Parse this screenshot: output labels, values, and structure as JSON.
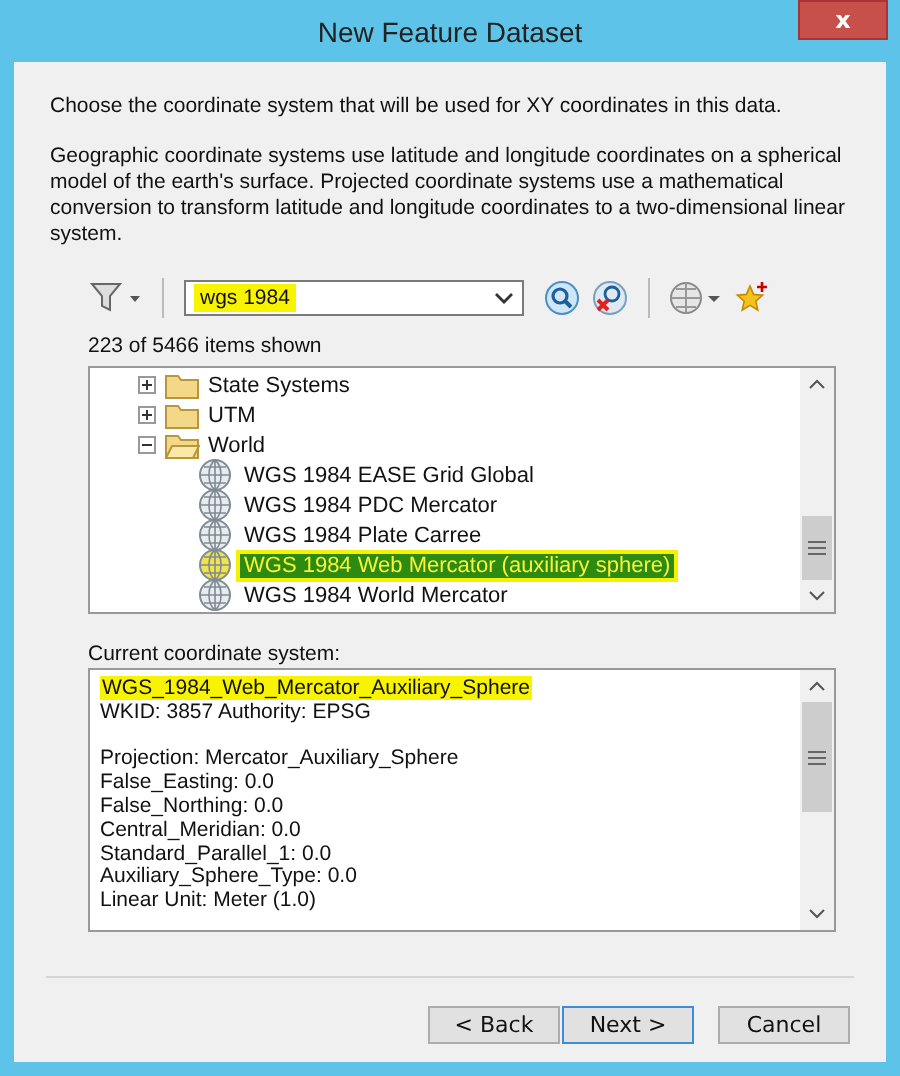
{
  "window": {
    "title": "New Feature Dataset",
    "close": "x"
  },
  "intro": "Choose the coordinate system that will be used for XY coordinates in this data.",
  "description": "Geographic coordinate systems use latitude and longitude coordinates on a spherical model of the earth's surface. Projected coordinate systems use a mathematical conversion to transform latitude and longitude coordinates to a two-dimensional linear system.",
  "search": {
    "value": "wgs 1984",
    "highlighted": true
  },
  "count": "223 of 5466 items shown",
  "tree": [
    {
      "label": "State Systems",
      "expanded": false
    },
    {
      "label": "UTM",
      "expanded": false
    },
    {
      "label": "World",
      "expanded": true,
      "children": [
        {
          "label": "WGS 1984 EASE Grid Global",
          "selected": false
        },
        {
          "label": "WGS 1984 PDC Mercator",
          "selected": false
        },
        {
          "label": "WGS 1984 Plate Carree",
          "selected": false
        },
        {
          "label": "WGS 1984 Web Mercator (auxiliary sphere)",
          "selected": true
        },
        {
          "label": "WGS 1984 World Mercator",
          "selected": false
        }
      ]
    }
  ],
  "current_label": "Current coordinate system:",
  "details": {
    "name": "WGS_1984_Web_Mercator_Auxiliary_Sphere",
    "highlighted": true,
    "wkid": "WKID: 3857 Authority: EPSG",
    "parameters": [
      "Projection: Mercator_Auxiliary_Sphere",
      "False_Easting: 0.0",
      "False_Northing: 0.0",
      "Central_Meridian: 0.0",
      "Standard_Parallel_1: 0.0",
      "Auxiliary_Sphere_Type: 0.0",
      "Linear Unit: Meter (1.0)"
    ]
  },
  "buttons": [
    {
      "label": "< Back",
      "disabled": false
    },
    {
      "label": "Next >",
      "disabled": false
    },
    {
      "label": "Cancel",
      "disabled": false
    }
  ]
}
